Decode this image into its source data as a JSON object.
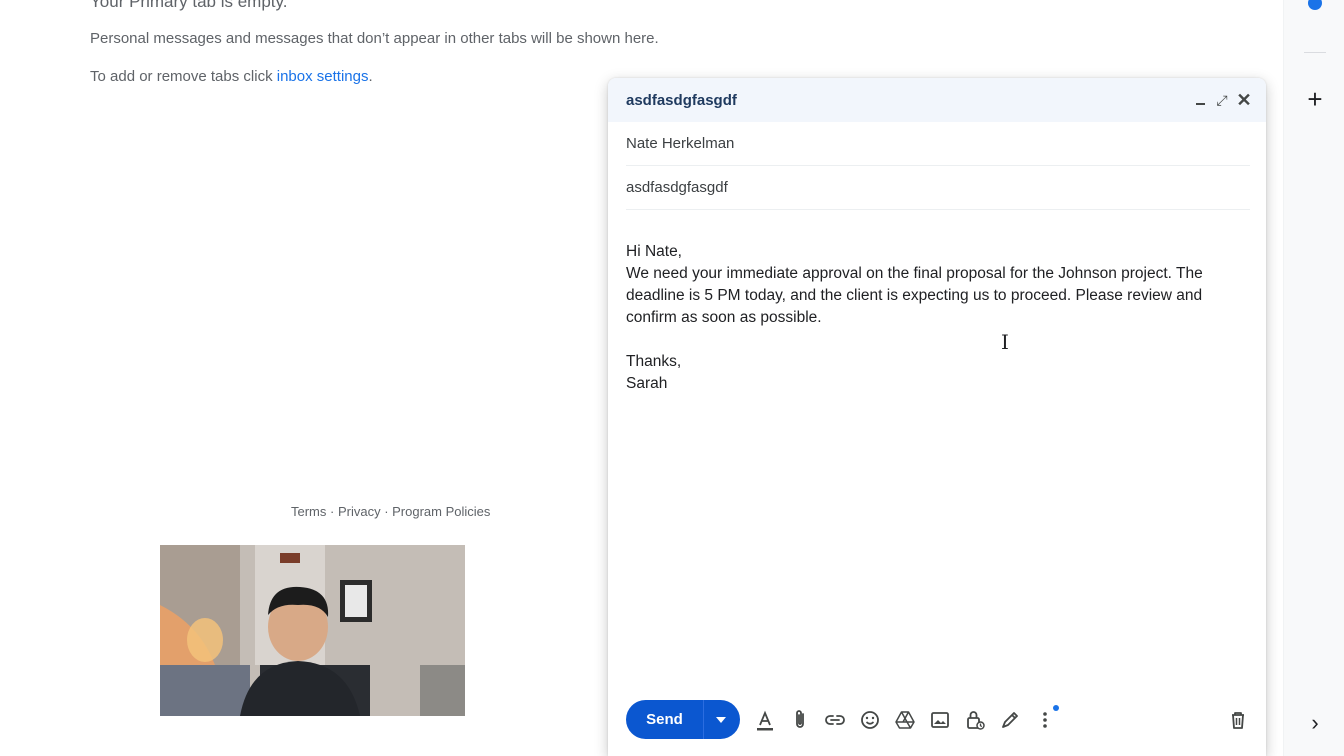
{
  "inbox": {
    "empty_title": "Your Primary tab is empty.",
    "empty_message": "Personal messages and messages that don’t appear in other tabs will be shown here.",
    "tabs_hint_prefix": "To add or remove tabs click ",
    "tabs_hint_link": "inbox settings",
    "tabs_hint_suffix": "."
  },
  "footer": {
    "terms": "Terms",
    "sep1": " · ",
    "privacy": "Privacy",
    "sep2": " · ",
    "program_policies": "Program Policies"
  },
  "compose": {
    "title": "asdfasdgfasgdf",
    "to": "Nate Herkelman",
    "subject": "asdfasdgfasgdf",
    "body": "Hi Nate,\nWe need your immediate approval on the final proposal for the Johnson project. The deadline is 5 PM today, and the client is expecting us to proceed. Please review and confirm as soon as possible.\n\nThanks,\nSarah",
    "send_label": "Send",
    "toolbar_icons": [
      "text-format-icon",
      "attach-icon",
      "link-icon",
      "emoji-icon",
      "drive-icon",
      "photo-icon",
      "confidential-lock-icon",
      "signature-pen-icon",
      "more-options-icon",
      "discard-trash-icon"
    ],
    "accent_color": "#0b57d0",
    "header_color": "#f2f6fc"
  },
  "rail": {
    "icons": [
      "add-icon",
      "chevron-right-icon"
    ]
  }
}
